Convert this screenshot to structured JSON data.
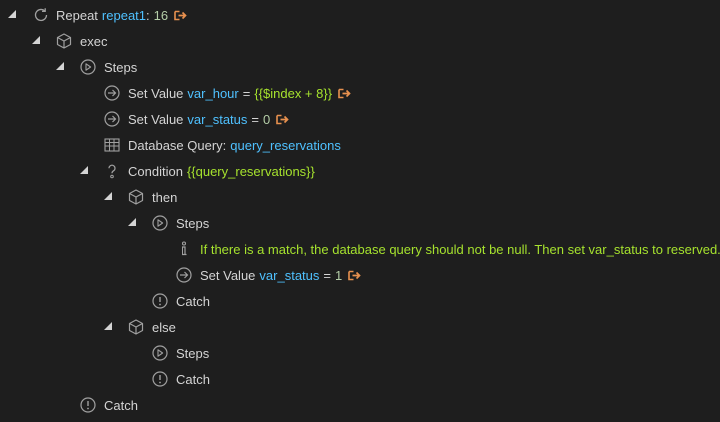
{
  "tree": {
    "repeat": {
      "label": "Repeat",
      "name": "repeat1",
      "sep": ":",
      "count": "16"
    },
    "exec": {
      "label": "exec"
    },
    "steps1": {
      "label": "Steps"
    },
    "set_hour": {
      "label": "Set Value",
      "var": "var_hour",
      "eq": "=",
      "value": "{{$index + 8}}"
    },
    "set_status0": {
      "label": "Set Value",
      "var": "var_status",
      "eq": "=",
      "value": "0"
    },
    "db_query": {
      "label": "Database Query:",
      "name": "query_reservations"
    },
    "condition": {
      "label": "Condition",
      "expr": "{{query_reservations}}"
    },
    "then": {
      "label": "then"
    },
    "then_steps": {
      "label": "Steps"
    },
    "comment": {
      "text": "If there is a match, the database query should not be null. Then set var_status to reserved."
    },
    "set_status1": {
      "label": "Set Value",
      "var": "var_status",
      "eq": "=",
      "value": "1"
    },
    "then_catch": {
      "label": "Catch"
    },
    "else": {
      "label": "else"
    },
    "else_steps": {
      "label": "Steps"
    },
    "else_catch": {
      "label": "Catch"
    },
    "outer_catch": {
      "label": "Catch"
    }
  },
  "colors": {
    "background": "#1e1e1e",
    "text": "#d4d4d4",
    "name": "#4fc1ff",
    "number": "#b5cea8",
    "expression": "#a6e22e",
    "link_arrow": "#e8914f",
    "icon": "#a0a0a0"
  },
  "icons": [
    "refresh-icon",
    "cube-icon",
    "play-circle-icon",
    "arrow-circle-icon",
    "table-icon",
    "question-icon",
    "info-icon",
    "alert-circle-icon",
    "link-out-icon"
  ]
}
